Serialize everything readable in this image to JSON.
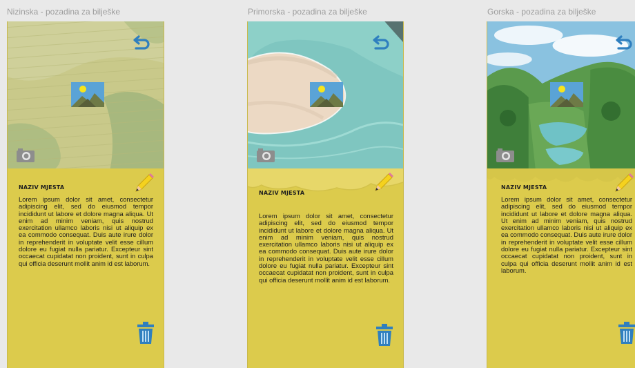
{
  "frames": [
    {
      "title": "Nizinska - pozadina za bilješke",
      "scene": "field",
      "place_name": "NAZIV MJESTA",
      "text": "Lorem ipsum dolor sit amet, consectetur adipiscing elit, sed do eiusmod tempor incididunt ut labore et dolore magna aliqua. Ut enim ad minim veniam, quis nostrud exercitation ullamco laboris nisi ut aliquip ex ea commodo consequat. Duis aute irure dolor in reprehenderit in voluptate velit esse cillum dolore eu fugiat nulla pariatur. Excepteur sint occaecat cupidatat non proident, sunt in culpa qui officia deserunt mollit anim id est laborum."
    },
    {
      "title": "Primorska - pozadina za bilješke",
      "scene": "coast",
      "place_name": "NAZIV MJESTA",
      "text": "Lorem ipsum dolor sit amet, consectetur adipiscing elit, sed do eiusmod tempor incididunt ut labore et dolore magna aliqua. Ut enim ad minim veniam, quis nostrud exercitation ullamco laboris nisi ut aliquip ex ea commodo consequat. Duis aute irure dolor in reprehenderit in voluptate velit esse cillum dolore eu fugiat nulla pariatur. Excepteur sint occaecat cupidatat non proident, sunt in culpa qui officia deserunt mollit anim id est laborum."
    },
    {
      "title": "Gorska - pozadina za bilješke",
      "scene": "mountain",
      "place_name": "NAZIV MJESTA",
      "text": "Lorem ipsum dolor sit amet, consectetur adipiscing elit, sed do eiusmod tempor incididunt ut labore et dolore magna aliqua. Ut enim ad minim veniam, quis nostrud exercitation ullamco laboris nisi ut aliquip ex ea commodo consequat. Duis aute irure dolor in reprehenderit in voluptate velit esse cillum dolore eu fugiat nulla pariatur. Excepteur sint occaecat cupidatat non proident, sunt in culpa qui officia deserunt mollit anim id est laborum."
    }
  ],
  "icons": {
    "back": "undo-icon",
    "gallery": "image-icon",
    "camera": "camera-icon",
    "edit": "pencil-icon",
    "delete": "trash-icon"
  },
  "colors": {
    "page_background": "#e9e9e9",
    "note_background": "#dccb4c",
    "icon_blue": "#2f7fbf",
    "title_gray": "#9d9d9d"
  }
}
